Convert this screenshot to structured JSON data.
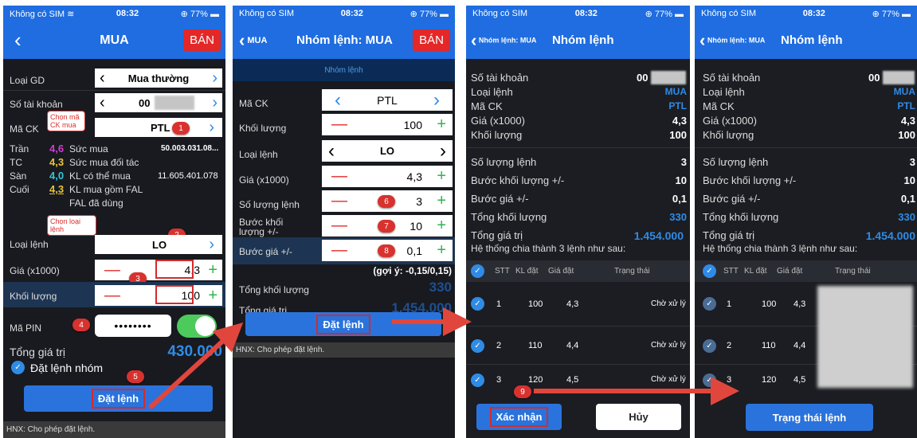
{
  "status": {
    "carrier": "Không có SIM",
    "time": "08:32",
    "battery": "77%"
  },
  "s1": {
    "title": "MUA",
    "sell": "BÁN",
    "loai_gd": {
      "label": "Loại GD",
      "value": "Mua thường"
    },
    "so_tk": {
      "label": "Số tài khoản",
      "value": "00"
    },
    "ma_ck": {
      "label": "Mã CK",
      "value": "PTL",
      "callout": "Chọn mã CK mua"
    },
    "info": [
      {
        "k": "Trần",
        "v": "4,6",
        "t": "Sức mua",
        "x": "50.003.031.08..."
      },
      {
        "k": "TC",
        "v": "4,3",
        "t": "Sức mua đối tác",
        "x": ""
      },
      {
        "k": "Sàn",
        "v": "4,0",
        "t": "KL có thể mua",
        "x": "11.605.401.078"
      },
      {
        "k": "Cuối",
        "v": "4,3",
        "t": "KL mua gồm FAL",
        "x": ""
      }
    ],
    "fal": "FAL đã dùng",
    "loai_lenh": {
      "label": "Loại lệnh",
      "value": "LO",
      "callout": "Chọn loại lệnh"
    },
    "gia": {
      "label": "Giá (x1000)",
      "value": "4,3"
    },
    "kl": {
      "label": "Khối lượng",
      "value": "100"
    },
    "pin": {
      "label": "Mã PIN",
      "value": "••••••••"
    },
    "tong": {
      "label": "Tổng giá trị",
      "value": "430.000"
    },
    "nhom": "Đặt lệnh nhóm",
    "btn": "Đặt lệnh",
    "footer": "HNX: Cho phép đặt lệnh.",
    "steps": [
      "1",
      "2",
      "3",
      "4",
      "5"
    ]
  },
  "s2": {
    "back": "MUA",
    "title": "Nhóm lệnh: MUA",
    "sell": "BÁN",
    "tab": "Nhóm lệnh",
    "rows": [
      {
        "label": "Mã CK",
        "value": "PTL"
      },
      {
        "label": "Khối lượng",
        "value": "100"
      },
      {
        "label": "Loại lệnh",
        "value": "LO"
      },
      {
        "label": "Giá (x1000)",
        "value": "4,3"
      },
      {
        "label": "Số lượng lệnh",
        "value": "3"
      },
      {
        "label": "Bước khối lượng +/-",
        "value": "10"
      },
      {
        "label": "Bước giá +/-",
        "value": "0,1"
      }
    ],
    "hint": "(gợi ý: -0,15/0,15)",
    "tong_kl": {
      "label": "Tổng khối lượng",
      "value": "330"
    },
    "tong_gt": {
      "label": "Tổng giá trị",
      "value": "1.454.000"
    },
    "btn": "Đặt lệnh",
    "footer": "HNX: Cho phép đặt lệnh.",
    "steps": [
      "6",
      "7",
      "8"
    ]
  },
  "s3": {
    "back": "Nhóm lệnh: MUA",
    "title": "Nhóm lệnh",
    "info": [
      {
        "k": "Số tài khoản",
        "v": "00"
      },
      {
        "k": "Loại lệnh",
        "v": "MUA"
      },
      {
        "k": "Mã CK",
        "v": "PTL"
      },
      {
        "k": "Giá (x1000)",
        "v": "4,3"
      },
      {
        "k": "Khối lượng",
        "v": "100"
      }
    ],
    "info2": [
      {
        "k": "Số lượng lệnh",
        "v": "3"
      },
      {
        "k": "Bước khối lượng +/-",
        "v": "10"
      },
      {
        "k": "Bước giá +/-",
        "v": "0,1"
      },
      {
        "k": "Tổng khối lượng",
        "v": "330"
      }
    ],
    "tong_gt": {
      "k": "Tổng giá trị",
      "v": "1.454.000"
    },
    "split": "Hệ thống chia thành 3 lệnh như sau:",
    "cols": [
      "STT",
      "KL đặt",
      "Giá đặt",
      "Trạng thái"
    ],
    "rows": [
      {
        "stt": "1",
        "kl": "100",
        "gia": "4,3",
        "tt": "Chờ xử lý"
      },
      {
        "stt": "2",
        "kl": "110",
        "gia": "4,4",
        "tt": "Chờ xử lý"
      },
      {
        "stt": "3",
        "kl": "120",
        "gia": "4,5",
        "tt": "Chờ xử lý"
      }
    ],
    "confirm": "Xác nhận",
    "cancel": "Hủy",
    "step": "9"
  },
  "s4": {
    "back": "Nhóm lệnh: MUA",
    "title": "Nhóm lệnh",
    "btn": "Trạng thái lệnh"
  }
}
